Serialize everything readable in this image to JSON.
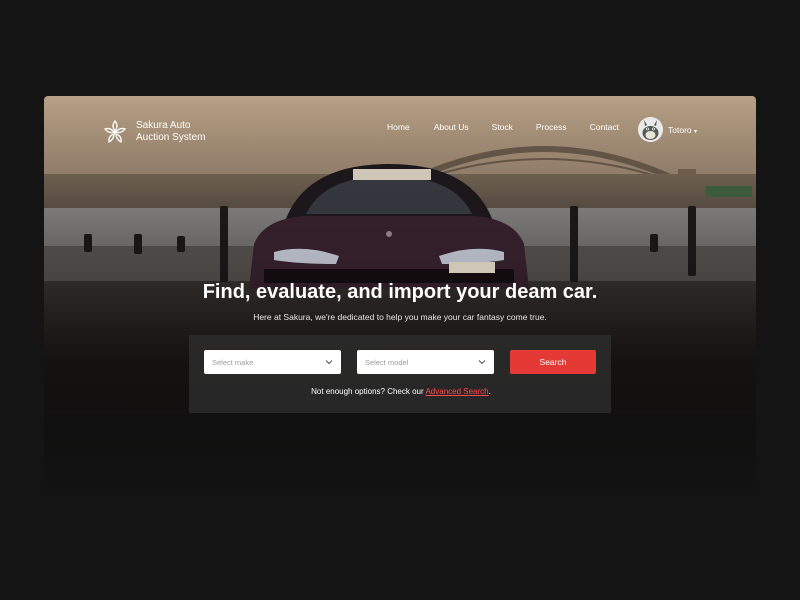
{
  "brand": {
    "logo_icon": "sakura-flower-icon",
    "name_line1": "Sakura Auto",
    "name_line2": "Auction System"
  },
  "nav": {
    "items": [
      "Home",
      "About Us",
      "Stock",
      "Process",
      "Contact"
    ]
  },
  "user": {
    "avatar_icon": "totoro-avatar-icon",
    "name": "Totoro"
  },
  "hero": {
    "headline": "Find, evaluate, and import your deam car.",
    "subline": "Here at Sakura, we're dedicated to help you make your car fantasy come true."
  },
  "search": {
    "make_placeholder": "Select make",
    "model_placeholder": "Select model",
    "button_label": "Search",
    "advanced_prefix": "Not enough options? Check our ",
    "advanced_link": "Advanced Search",
    "advanced_suffix": "."
  },
  "colors": {
    "accent": "#e53935",
    "link": "#ff4a4a",
    "page_bg": "#141414"
  }
}
